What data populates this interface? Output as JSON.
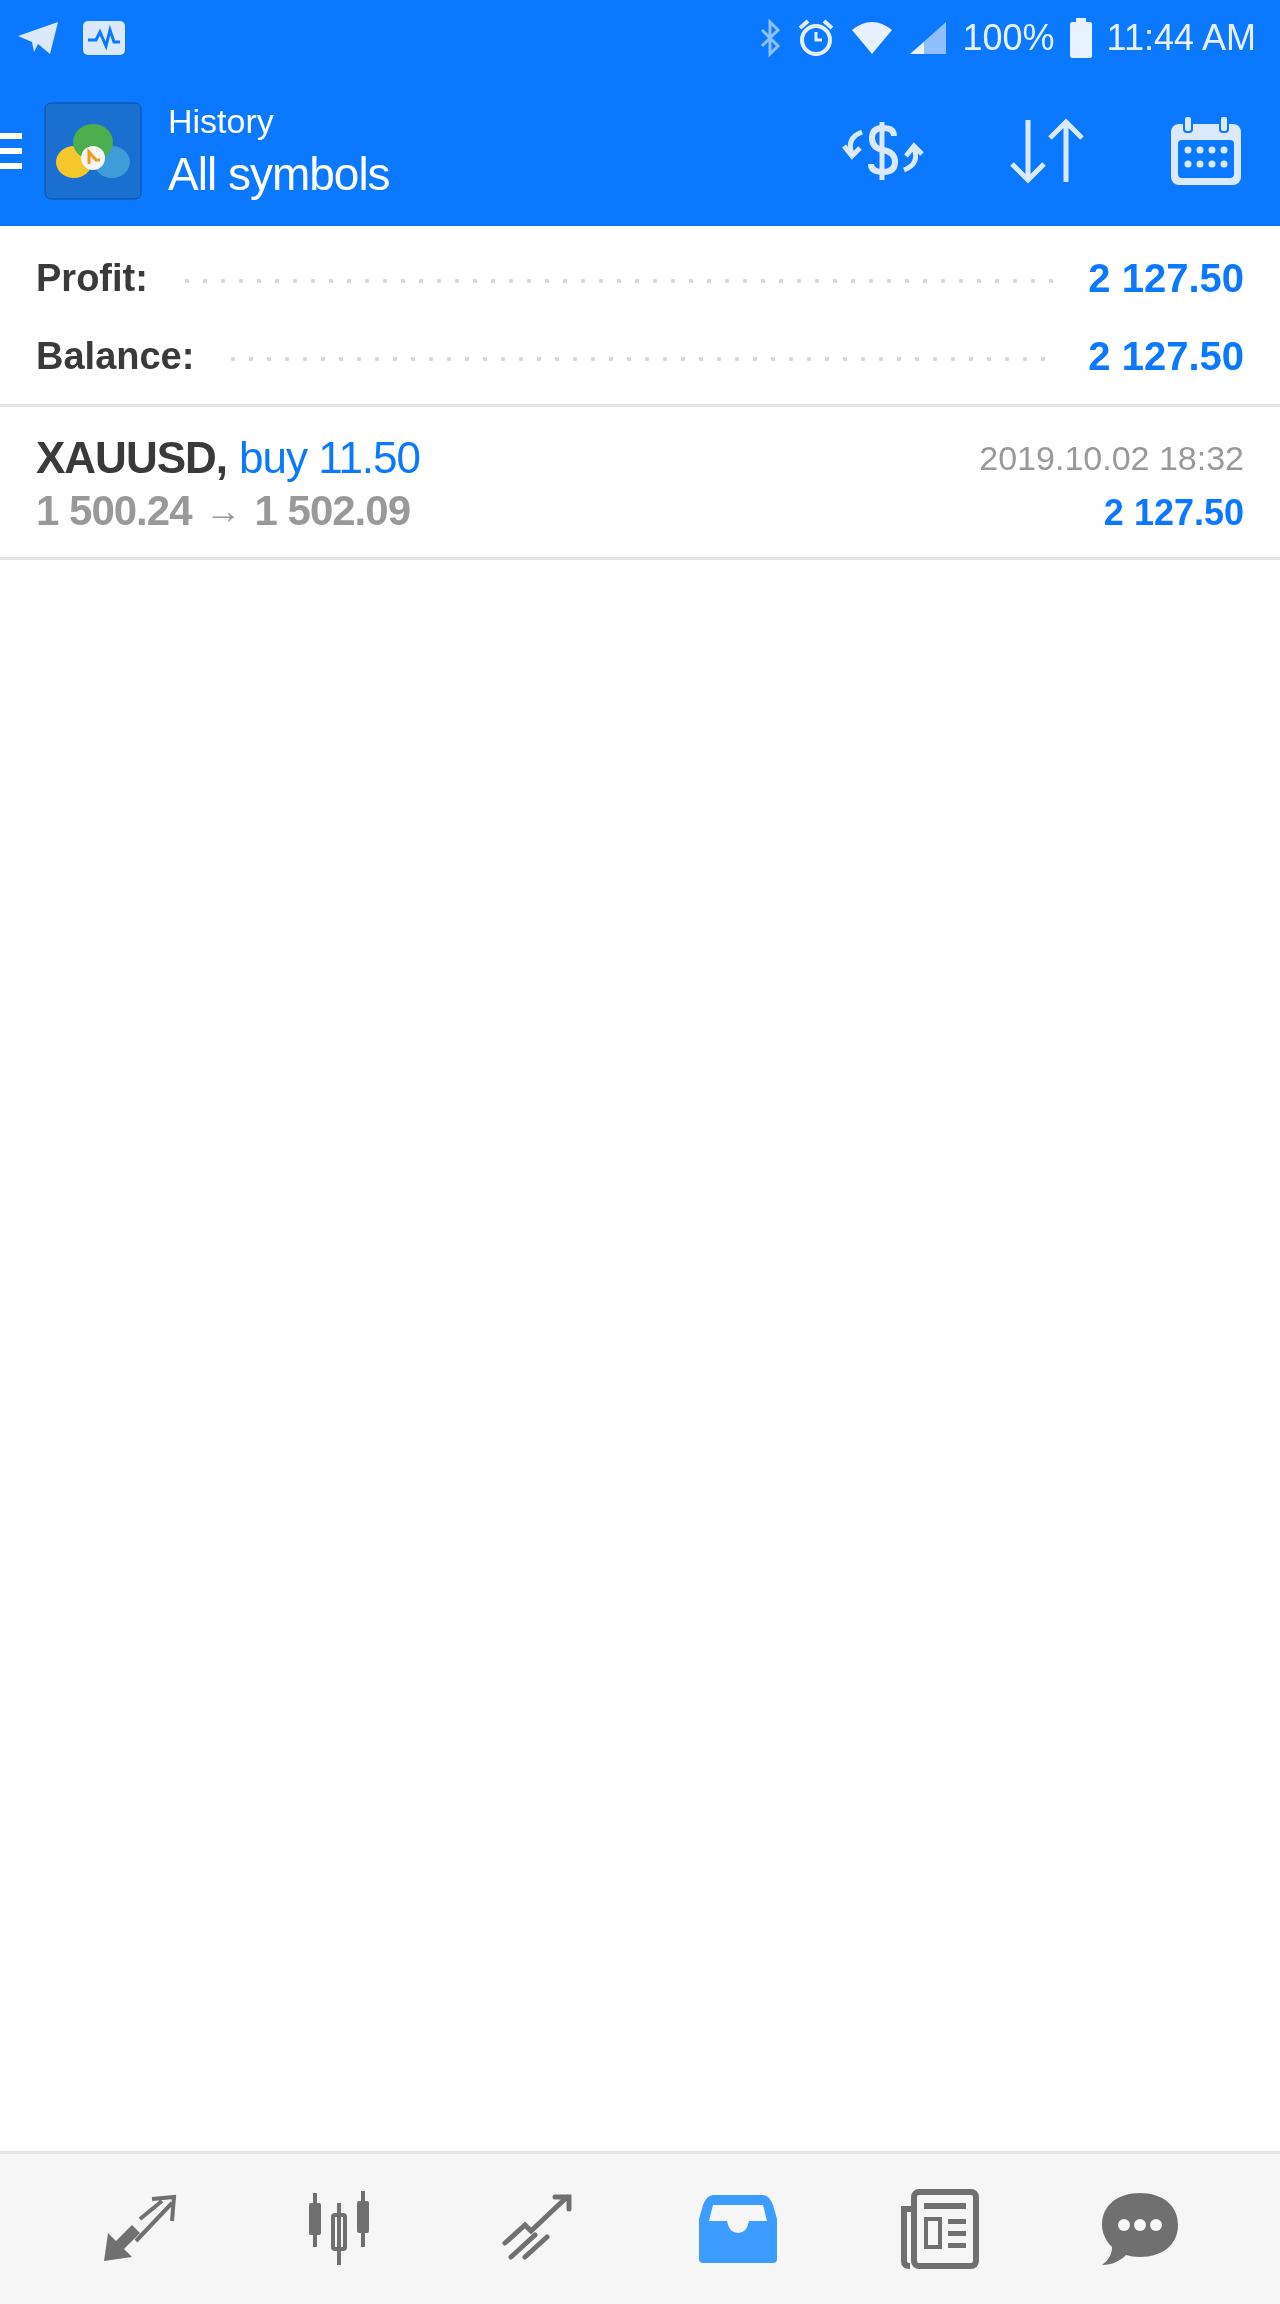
{
  "status_bar": {
    "battery": "100%",
    "time": "11:44 AM"
  },
  "header": {
    "title": "History",
    "subtitle": "All symbols"
  },
  "summary": [
    {
      "label": "Profit:",
      "value": "2 127.50"
    },
    {
      "label": "Balance:",
      "value": "2 127.50"
    }
  ],
  "trades": [
    {
      "symbol": "XAUUSD,",
      "order": "buy 11.50",
      "open_price": "1 500.24",
      "arrow": "→",
      "close_price": "1 502.09",
      "time": "2019.10.02 18:32",
      "profit": "2 127.50"
    }
  ],
  "nav": [
    {
      "kind": "quotes",
      "selected": false
    },
    {
      "kind": "chart",
      "selected": false
    },
    {
      "kind": "trade",
      "selected": false
    },
    {
      "kind": "history",
      "selected": true
    },
    {
      "kind": "news",
      "selected": false
    },
    {
      "kind": "chat",
      "selected": false
    }
  ]
}
